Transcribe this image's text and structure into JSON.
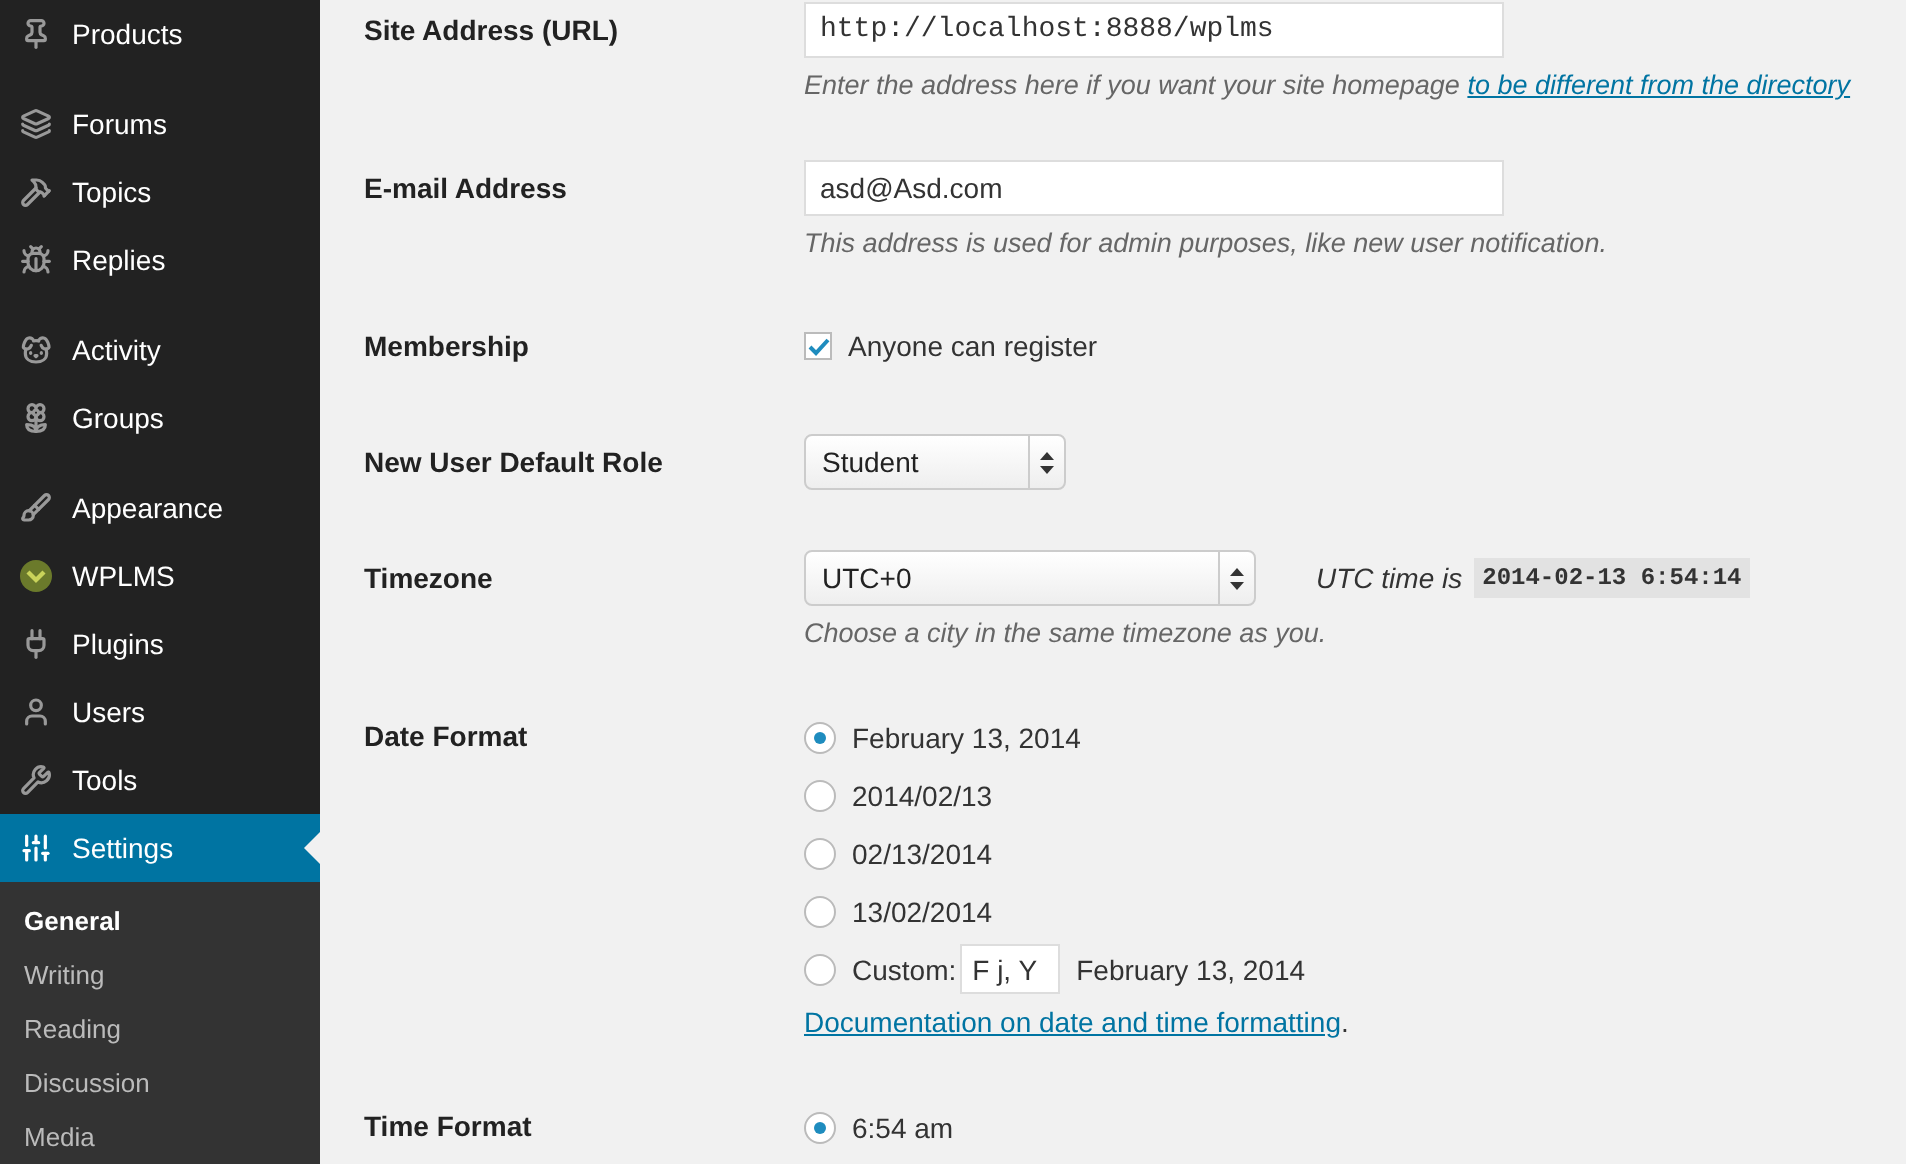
{
  "sidebar": {
    "groups": [
      [
        {
          "label": "Products",
          "selected": false
        }
      ],
      [
        {
          "label": "Forums",
          "selected": false
        },
        {
          "label": "Topics",
          "selected": false
        },
        {
          "label": "Replies",
          "selected": false
        }
      ],
      [
        {
          "label": "Activity",
          "selected": false
        },
        {
          "label": "Groups",
          "selected": false
        }
      ],
      [
        {
          "label": "Appearance",
          "selected": false
        },
        {
          "label": "WPLMS",
          "selected": false
        },
        {
          "label": "Plugins",
          "selected": false
        },
        {
          "label": "Users",
          "selected": false
        },
        {
          "label": "Tools",
          "selected": false
        },
        {
          "label": "Settings",
          "selected": true
        }
      ]
    ],
    "submenu": [
      {
        "label": "General",
        "selected": true
      },
      {
        "label": "Writing",
        "selected": false
      },
      {
        "label": "Reading",
        "selected": false
      },
      {
        "label": "Discussion",
        "selected": false
      },
      {
        "label": "Media",
        "selected": false
      }
    ]
  },
  "form": [
    {
      "kind": "text",
      "label": "Site Address (URL)",
      "value": "http://localhost:8888/wplms",
      "description": "Enter the address here if you want your site homepage ",
      "description_link": "to be different from the directory"
    },
    {
      "kind": "text",
      "label": "E-mail Address",
      "value": "asd@Asd.com",
      "description": "This address is used for admin purposes, like new user notification."
    },
    {
      "kind": "checkbox",
      "label": "Membership",
      "option": "Anyone can register",
      "checked": true
    },
    {
      "kind": "select",
      "label": "New User Default Role",
      "value": "Student",
      "wide": false
    },
    {
      "kind": "select",
      "label": "Timezone",
      "value": "UTC+0",
      "wide": true,
      "aside": "UTC time is",
      "aside_code": "2014-02-13 6:54:14",
      "description": "Choose a city in the same timezone as you."
    },
    {
      "kind": "radio",
      "label": "Date Format",
      "options": [
        {
          "label": "February 13, 2014",
          "selected": true
        },
        {
          "label": "2014/02/13",
          "selected": false
        },
        {
          "label": "02/13/2014",
          "selected": false
        },
        {
          "label": "13/02/2014",
          "selected": false
        },
        {
          "label": "Custom:",
          "selected": false,
          "custom_value": "F j, Y",
          "preview": "February 13, 2014"
        }
      ],
      "link": "Documentation on date and time formatting",
      "link_suffix": "."
    },
    {
      "kind": "radio",
      "label": "Time Format",
      "options": [
        {
          "label": "6:54 am",
          "selected": true
        }
      ]
    }
  ]
}
